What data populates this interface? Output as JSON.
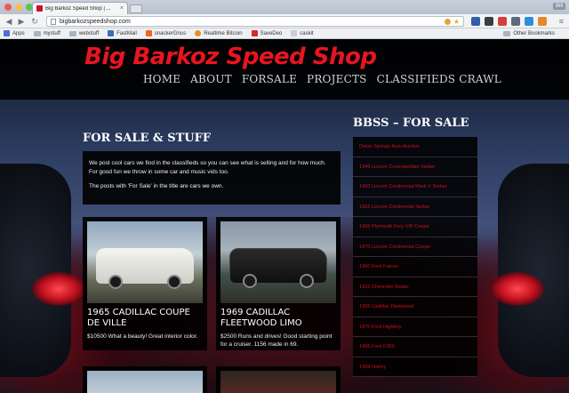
{
  "browser": {
    "tab_title": "Big Barkoz Speed Shop | ...",
    "tab_close": "×",
    "profile": "Bill",
    "url": "bigbarkozspeedshop.com",
    "bookmarks": [
      {
        "label": "Apps",
        "icon": "apps-icon",
        "color": "#4a6ed1"
      },
      {
        "label": "mystuff",
        "icon": "folder-icon",
        "color": "#a9b4c2"
      },
      {
        "label": "webstuff",
        "icon": "folder-icon",
        "color": "#a9b4c2"
      },
      {
        "label": "FastMail",
        "icon": "fastmail-icon",
        "color": "#3b6fb6"
      },
      {
        "label": "snackerGnus",
        "icon": "y-icon",
        "color": "#f26522"
      },
      {
        "label": "Realtime Bitcoin",
        "icon": "bitcoin-icon",
        "color": "#e98f2a"
      },
      {
        "label": "SaveDeo",
        "icon": "savedeo-icon",
        "color": "#d52b2b"
      },
      {
        "label": "caskit",
        "icon": "page-icon",
        "color": "#c9ced6"
      }
    ],
    "other_bookmarks": "Other Bookmarks"
  },
  "site": {
    "title": "Big Barkoz Speed Shop",
    "nav": [
      "HOME",
      "ABOUT",
      "FORSALE",
      "PROJECTS",
      "CLASSIFIEDS CRAWL"
    ],
    "section_heading": "FOR SALE & STUFF",
    "intro": [
      "We post cool cars we find in the classifieds so you can see what is selling and for how much. For good fun we throw in some car and music vids too.",
      "The posts with 'For Sale' in the title are cars we own."
    ],
    "cards": [
      {
        "title": "1965 CADILLAC COUPE DE VILLE",
        "desc": "$10500 What a beauty! Great interior color."
      },
      {
        "title": "1969 CADILLAC FLEETWOOD LIMO",
        "desc": "$2500 Runs and drives! Good starting point for a cruiser. 1156 made in 69."
      }
    ],
    "sidebar_heading": "BBSS – FOR SALE",
    "sidebar_items": [
      "Dolan Springs Auto Auction",
      "1949 Lincoln Cosmopolitan Sedan",
      "1960 Lincoln Continental Mark V Sedan",
      "1962 Lincoln Continental Sedan",
      "1966 Plymouth Fury VIP Coupe",
      "1970 Lincoln Continental Coupe",
      "1960 Ford Falcon",
      "1932 Chevrolet Sedan",
      "1956 Cadillac Fleetwood",
      "1970 Ford Highboy",
      "1966 Ford F350",
      "1959 Harley"
    ]
  },
  "colors": {
    "brand_red": "#e8151f",
    "sidebar_link": "#c8141e"
  }
}
